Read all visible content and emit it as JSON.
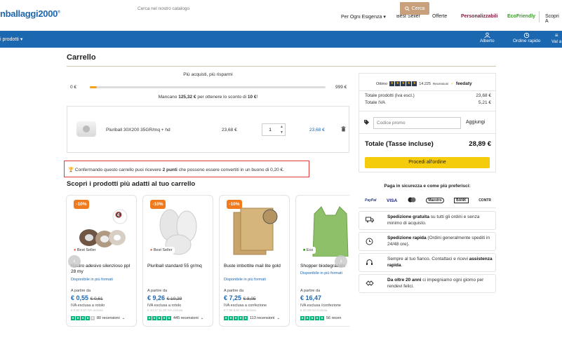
{
  "header": {
    "logo": "nballaggi2000",
    "logo_mark": "®",
    "nav": [
      "Per Ogni Esigenza",
      "Best Seller",
      "Offerte",
      "Personalizzabili",
      "EcoFriendly",
      "Scopri A"
    ],
    "nav_dropdown_icon": "▾"
  },
  "bluebar": {
    "categories_label": "i prodotti",
    "search_placeholder": "Cerca nel nostro catalogo",
    "search_button": "Cerca",
    "account_label": "Alberto",
    "reorder_label": "Ordine rapido",
    "more_label": "Val a"
  },
  "cart": {
    "title": "Carrello",
    "promo_heading": "Più acquisti, più risparmi",
    "progress_min": "0 €",
    "progress_max": "999 €",
    "progress_fraction": 0.03,
    "remaining_prefix": "Mancano",
    "remaining_amount": "125,32 €",
    "remaining_mid": "per ottenere lo sconto di",
    "remaining_discount": "10 €",
    "remaining_suffix": "!",
    "item": {
      "name": "Pluriball 30X200 35GR/mq + hd",
      "unit_price": "23,68 €",
      "quantity": "1",
      "total": "23,68 €"
    },
    "points_prefix": "Confermando questo carrello puoi ricevere",
    "points_value": "2 punti",
    "points_suffix": "che possono essere convertiti in un buono di 0,20 €."
  },
  "recommend": {
    "title": "Scopri i prodotti più adatti al tuo carrello",
    "price_prefix": "A partire da",
    "products": [
      {
        "discount": "-10%",
        "badge": "Best Seller",
        "name": "Nastro adesivo silenzioso ppl 28 my",
        "availability": "Disponibile in più formati",
        "price": "€ 0,55",
        "old_price": "€ 0,61",
        "vat": "IVA esclusa a rotolo",
        "faint": "€ 0,60 0,67 IVA inclusa",
        "reviews": "80 recensioni",
        "stars": 4
      },
      {
        "discount": "-10%",
        "badge": "Best Seller",
        "name": "Pluriball standard 55 gr/mq",
        "availability": "",
        "price": "€ 9,26",
        "old_price": "€ 10,29",
        "vat": "IVA esclusa a rotolo",
        "faint": "€ 10,17 11,30 IVA inclusa",
        "reviews": "445 recensioni",
        "stars": 5
      },
      {
        "discount": "-10%",
        "badge": "",
        "name": "Buste imbottite mail lite gold",
        "availability": "Disponibile in più formati",
        "price": "€ 7,25",
        "old_price": "€ 8,05",
        "vat": "IVA esclusa a confezione",
        "faint": "€ 7,96 8,84 IVA inclusa",
        "reviews": "113 recensioni",
        "stars": 5
      },
      {
        "discount": "",
        "badge": "Eco",
        "name": "Shopper biodegradabi",
        "availability": "Disponibile in più formati",
        "price": "€ 16,47",
        "old_price": "",
        "vat": "IVA esclusa /confezione",
        "faint": "€ 20,09 IVA inclusa",
        "reviews": "56 recen",
        "stars": 5
      }
    ]
  },
  "summary": {
    "feedaty_label": "Ottimo",
    "feedaty_count": "14.225",
    "feedaty_reviews": "Recensioni",
    "feedaty_brand": "feedaty",
    "subtotal_label": "Totale prodotti (Iva escl.)",
    "subtotal_value": "23,68 €",
    "vat_label": "Totale IVA",
    "vat_value": "5,21 €",
    "coupon_placeholder": "Codice promo",
    "coupon_apply": "Aggiungi",
    "total_label": "Totale (Tasse incluse)",
    "total_value": "28,89 €",
    "checkout": "Procedi all'ordine"
  },
  "payments": {
    "title": "Paga in sicurezza e come più preferisci:",
    "methods": [
      "PayPal",
      "VISA",
      "MC",
      "Maestro",
      "BANK",
      "CONTR"
    ]
  },
  "features": [
    {
      "icon": "truck-icon",
      "bold": "Spedizione gratuita",
      "text": " su tutti gli ordini e senza minimo di acquisto.",
      "bold_first": true
    },
    {
      "icon": "clock-icon",
      "bold": "Spedizione rapida",
      "text": " (Ordini generalmente spediti in 24/48 ore).",
      "bold_first": true
    },
    {
      "icon": "support-icon",
      "bold": "assistenza rapida",
      "text": "Sempre al tuo fianco. Contattaci e ricevi ",
      "bold_first": false,
      "suffix": "."
    },
    {
      "icon": "handshake-icon",
      "bold": "Da oltre 20 anni",
      "text": " ci impegniamo ogni giorno per rendevi felici.",
      "bold_first": true
    }
  ]
}
